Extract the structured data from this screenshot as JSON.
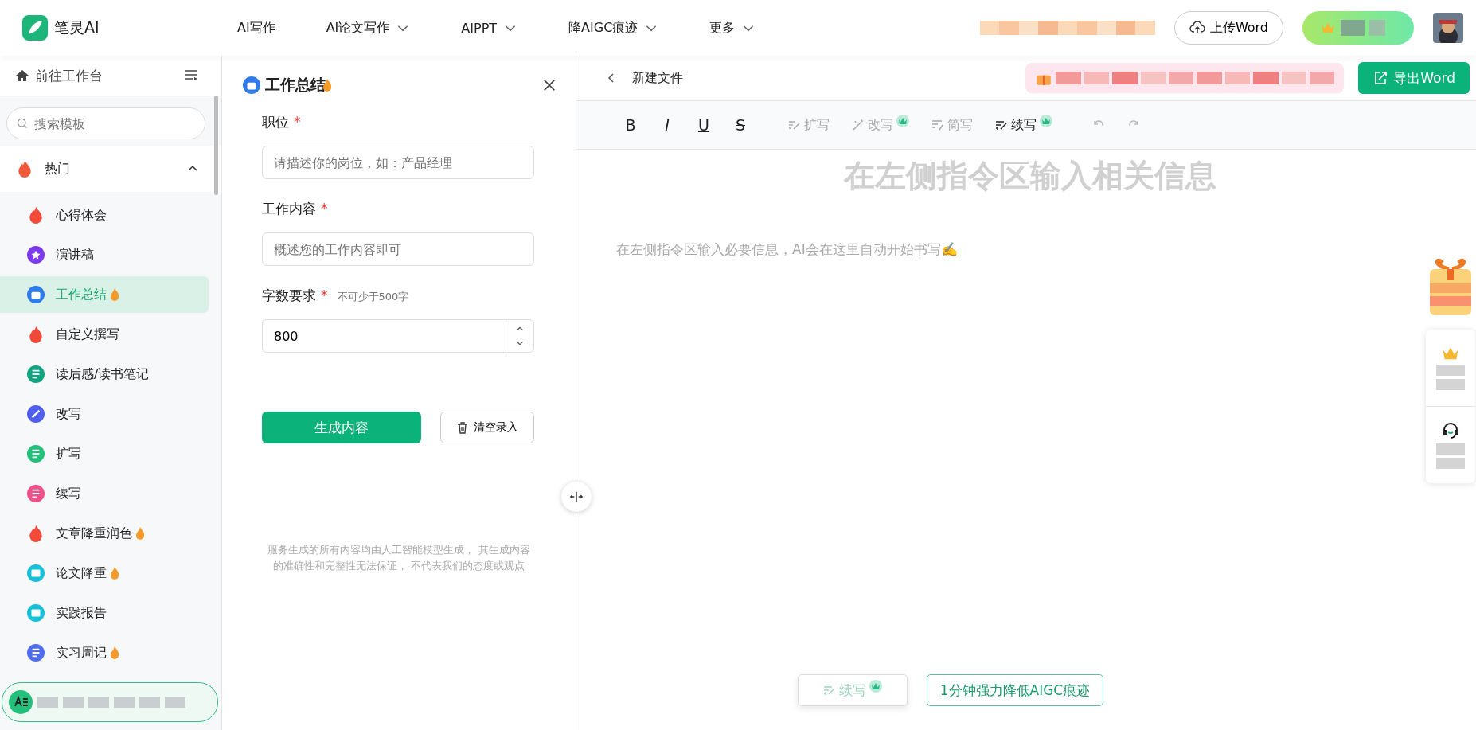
{
  "brand": {
    "name": "笔灵AI"
  },
  "nav": [
    {
      "label": "AI写作",
      "dropdown": false
    },
    {
      "label": "AI论文写作",
      "dropdown": true
    },
    {
      "label": "AIPPT",
      "dropdown": true
    },
    {
      "label": "降AIGC痕迹",
      "dropdown": true
    },
    {
      "label": "更多",
      "dropdown": true
    }
  ],
  "upload_button": "上传Word",
  "sidebar": {
    "home": "前往工作台",
    "search": {
      "placeholder": "搜索模板"
    },
    "section": {
      "label": "热门",
      "expanded": true
    },
    "items": [
      {
        "label": "心得体会",
        "kind": "hot",
        "color": "#f04a3a",
        "hot": false,
        "selected": false
      },
      {
        "label": "演讲稿",
        "kind": "star",
        "color": "#7c3aed",
        "hot": false,
        "selected": false
      },
      {
        "label": "工作总结",
        "kind": "briefcase",
        "color": "#2f7be8",
        "hot": true,
        "selected": true
      },
      {
        "label": "自定义撰写",
        "kind": "hot",
        "color": "#f04a3a",
        "hot": false,
        "selected": false
      },
      {
        "label": "读后感/读书笔记",
        "kind": "notebook",
        "color": "#10a37f",
        "hot": false,
        "selected": false
      },
      {
        "label": "改写",
        "kind": "wand",
        "color": "#4f5ff0",
        "hot": false,
        "selected": false
      },
      {
        "label": "扩写",
        "kind": "pen",
        "color": "#22c07a",
        "hot": false,
        "selected": false
      },
      {
        "label": "续写",
        "kind": "pen",
        "color": "#f0508a",
        "hot": false,
        "selected": false
      },
      {
        "label": "文章降重润色",
        "kind": "hot",
        "color": "#f04a3a",
        "hot": true,
        "selected": false
      },
      {
        "label": "论文降重",
        "kind": "card",
        "color": "#16c0d8",
        "hot": true,
        "selected": false
      },
      {
        "label": "实践报告",
        "kind": "card",
        "color": "#16c0d8",
        "hot": false,
        "selected": false
      },
      {
        "label": "实习周记",
        "kind": "doc",
        "color": "#4f6cf0",
        "hot": true,
        "selected": false
      }
    ]
  },
  "form": {
    "title": "工作总结",
    "title_hot": true,
    "fields": [
      {
        "label": "职位",
        "required": true,
        "marker": "*",
        "kind": "text",
        "placeholder": "请描述你的岗位，如：产品经理"
      },
      {
        "label": "工作内容",
        "required": true,
        "marker": "*",
        "kind": "text",
        "placeholder": "概述您的工作内容即可"
      },
      {
        "label": "字数要求",
        "required": true,
        "marker": "*",
        "hint": "不可少于500字",
        "kind": "number",
        "value": "800"
      }
    ],
    "generate_button": "生成内容",
    "clear_button": "清空录入",
    "disclaimer": "服务生成的所有内容均由人工智能模型生成， 其生成内容的准确性和完整性无法保证， 不代表我们的态度或观点"
  },
  "editor": {
    "file_name": "新建文件",
    "export_button": "导出Word",
    "format_buttons": [
      {
        "label": "B",
        "kind": "bold"
      },
      {
        "label": "I",
        "kind": "italic"
      },
      {
        "label": "U",
        "kind": "underline"
      },
      {
        "label": "S",
        "kind": "strike"
      }
    ],
    "tools": [
      {
        "label": "扩写",
        "disabled": true,
        "vip": false,
        "kind": "expand"
      },
      {
        "label": "改写",
        "disabled": true,
        "vip": true,
        "kind": "rewrite"
      },
      {
        "label": "简写",
        "disabled": true,
        "vip": false,
        "kind": "shorten"
      },
      {
        "label": "续写",
        "disabled": false,
        "vip": true,
        "kind": "continue"
      }
    ],
    "heading": "在左侧指令区输入相关信息",
    "paragraph": "在左侧指令区输入必要信息，AI会在这里自动开始书写✍️",
    "bottom_buttons": [
      {
        "label": "续写",
        "kind": "continue",
        "disabled": true
      },
      {
        "label": "1分钟强力降低AIGC痕迹",
        "kind": "outline",
        "disabled": false
      }
    ]
  }
}
